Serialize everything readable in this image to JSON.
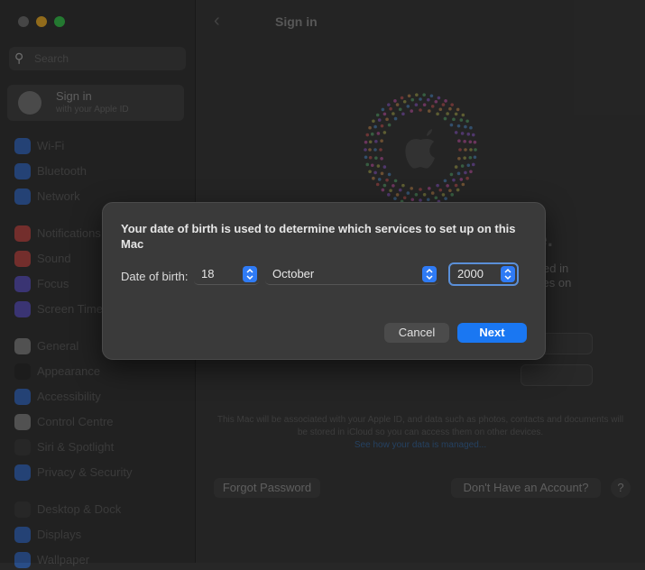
{
  "sidebar": {
    "search_placeholder": "Search",
    "signin": {
      "title": "Sign in",
      "subtitle": "with your Apple ID"
    },
    "items": [
      {
        "label": "Wi-Fi",
        "color": "#2c6cd6"
      },
      {
        "label": "Bluetooth",
        "color": "#2c6cd6"
      },
      {
        "label": "Network",
        "color": "#2c6cd6"
      },
      {
        "label": "Notifications",
        "color": "#d0433f"
      },
      {
        "label": "Sound",
        "color": "#d0433f"
      },
      {
        "label": "Focus",
        "color": "#5a4fcf"
      },
      {
        "label": "Screen Time",
        "color": "#5a4fcf"
      },
      {
        "label": "General",
        "color": "#8a8a8a"
      },
      {
        "label": "Appearance",
        "color": "#1c1c1c"
      },
      {
        "label": "Accessibility",
        "color": "#2c6cd6"
      },
      {
        "label": "Control Centre",
        "color": "#8a8a8a"
      },
      {
        "label": "Siri & Spotlight",
        "color": "#333333"
      },
      {
        "label": "Privacy & Security",
        "color": "#2c6cd6"
      },
      {
        "label": "Desktop & Dock",
        "color": "#333333"
      },
      {
        "label": "Displays",
        "color": "#2c6cd6"
      },
      {
        "label": "Wallpaper",
        "color": "#2c6cd6"
      }
    ]
  },
  "main": {
    "title": "Sign in",
    "behind": {
      "headline_fragment": "ple.",
      "line1_fragment": "ed in",
      "line2_fragment": "ces on"
    },
    "disclaimer": {
      "text": "This Mac will be associated with your Apple ID, and data such as photos, contacts and documents will be stored in iCloud so you can access them on other devices.",
      "link": "See how your data is managed..."
    },
    "forgot_password": "Forgot Password",
    "no_account": "Don't Have an Account?",
    "help": "?"
  },
  "dialog": {
    "message": "Your date of birth is used to determine which services to set up on this Mac",
    "dob_label": "Date of birth:",
    "day": "18",
    "month": "October",
    "year": "2000",
    "cancel": "Cancel",
    "next": "Next"
  }
}
